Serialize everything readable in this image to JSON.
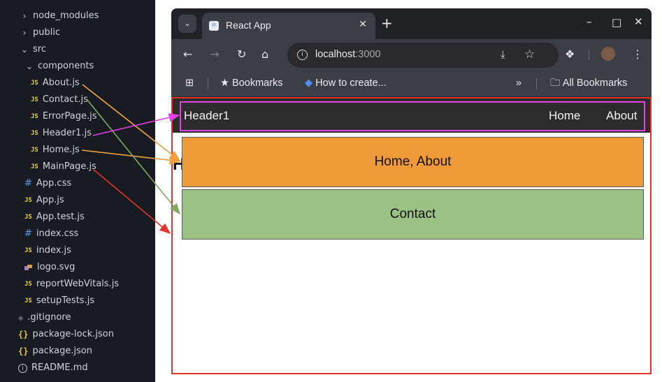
{
  "explorer": {
    "items": [
      {
        "label": "node_modules",
        "kind": "folder-collapsed"
      },
      {
        "label": "public",
        "kind": "folder-collapsed"
      },
      {
        "label": "src",
        "kind": "folder-expanded"
      },
      {
        "label": "components",
        "kind": "folder-expanded"
      },
      {
        "label": "About.js",
        "kind": "js"
      },
      {
        "label": "Contact.js",
        "kind": "js"
      },
      {
        "label": "ErrorPage.js",
        "kind": "js"
      },
      {
        "label": "Header1.js",
        "kind": "js"
      },
      {
        "label": "Home.js",
        "kind": "js"
      },
      {
        "label": "MainPage.js",
        "kind": "js"
      },
      {
        "label": "App.css",
        "kind": "css"
      },
      {
        "label": "App.js",
        "kind": "js"
      },
      {
        "label": "App.test.js",
        "kind": "js"
      },
      {
        "label": "index.css",
        "kind": "css"
      },
      {
        "label": "index.js",
        "kind": "js"
      },
      {
        "label": "logo.svg",
        "kind": "svg"
      },
      {
        "label": "reportWebVitals.js",
        "kind": "js"
      },
      {
        "label": "setupTests.js",
        "kind": "js"
      },
      {
        "label": ".gitignore",
        "kind": "git"
      },
      {
        "label": "package-lock.json",
        "kind": "json"
      },
      {
        "label": "package.json",
        "kind": "json"
      },
      {
        "label": "README.md",
        "kind": "info"
      }
    ],
    "js_badge": "JS",
    "css_badge": "#",
    "json_badge": "{}"
  },
  "browser": {
    "tab_title": "React App",
    "url_host": "localhost",
    "url_port": ":3000",
    "bookmarks": {
      "bookmarks_label": "Bookmarks",
      "how_to_label": "How to create...",
      "overflow": "»",
      "all_bookmarks": "All Bookmarks"
    }
  },
  "page": {
    "header_brand": "Header1",
    "nav_home": "Home",
    "nav_about": "About",
    "hidden_heading_char": "H",
    "box_home_text": "Home, About",
    "box_contact_text": "Contact"
  },
  "colors": {
    "explorer_bg": "#181b21",
    "header_bg": "#2c2c2c",
    "home_box": "#ef9a39",
    "contact_box": "#9cc184",
    "outline_red": "#e3342b",
    "outline_magenta": "#e540e8",
    "arrow_orange": "#f0a040",
    "arrow_green": "#7ea85f",
    "arrow_magenta": "#e540e8",
    "arrow_red": "#e3342b"
  }
}
